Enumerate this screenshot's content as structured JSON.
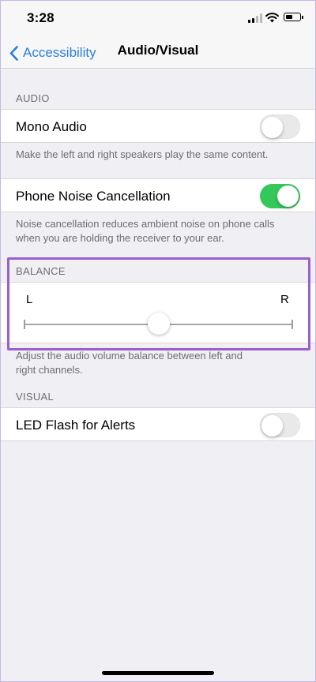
{
  "status_bar": {
    "time": "3:28",
    "battery_level": 0.55
  },
  "nav": {
    "back_label": "Accessibility",
    "title": "Audio/Visual"
  },
  "audio": {
    "header": "AUDIO",
    "mono_audio": {
      "label": "Mono Audio",
      "enabled": false
    },
    "mono_footer": "Make the left and right speakers play the same content.",
    "noise_cancellation": {
      "label": "Phone Noise Cancellation",
      "enabled": true
    },
    "noise_footer": "Noise cancellation reduces ambient noise on phone calls when you are holding the receiver to your ear."
  },
  "balance": {
    "header": "BALANCE",
    "left_label": "L",
    "right_label": "R",
    "value": 0.5,
    "footer": "Adjust the audio volume balance between left and right channels."
  },
  "visual": {
    "header": "VISUAL",
    "led_flash": {
      "label": "LED Flash for Alerts",
      "enabled": false
    }
  },
  "colors": {
    "accent": "#2a7de1",
    "toggle_on": "#34c759",
    "highlight": "#9a5fd1"
  }
}
